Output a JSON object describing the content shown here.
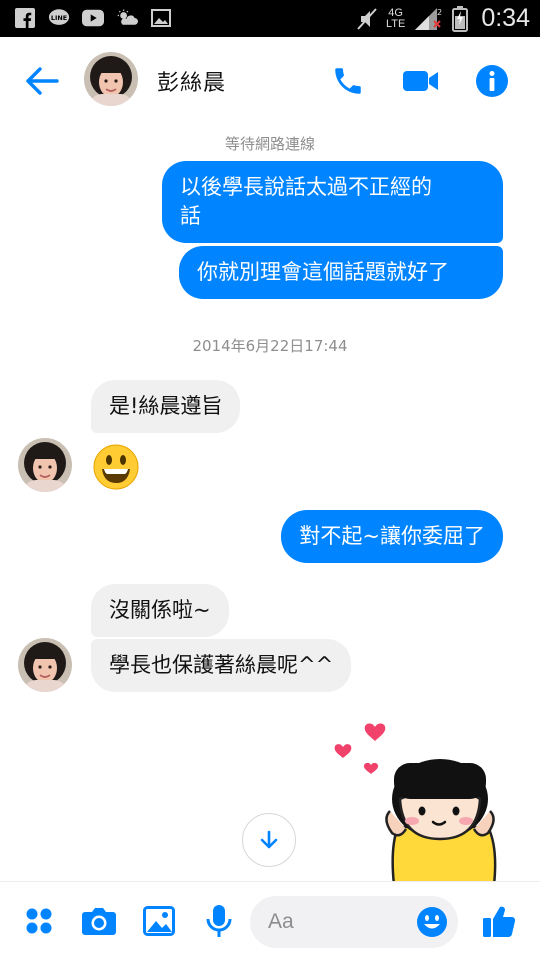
{
  "status_bar": {
    "network": "4G",
    "network_sub": "LTE",
    "sim_badge": "2",
    "time": "0:34",
    "icons": [
      "facebook-icon",
      "line-icon",
      "youtube-icon",
      "weather-icon",
      "gallery-icon",
      "mute-icon",
      "signal-icon",
      "battery-icon"
    ]
  },
  "header": {
    "contact_name": "彭絲晨",
    "icons": [
      "back-arrow-icon",
      "phone-icon",
      "video-camera-icon",
      "info-icon"
    ]
  },
  "thread": {
    "waiting_notice": "等待網路連線",
    "timestamp": "2014年6月22日17:44",
    "messages": [
      {
        "direction": "out",
        "text": "以後學長說話太過不正經的\n話"
      },
      {
        "direction": "out",
        "text": "你就別理會這個話題就好了"
      },
      {
        "direction": "in",
        "text": "是!絲晨遵旨"
      },
      {
        "direction": "in",
        "type": "emoji",
        "emoji": "grinning-face"
      },
      {
        "direction": "out",
        "text": "對不起~讓你委屈了"
      },
      {
        "direction": "in",
        "text": "沒關係啦~"
      },
      {
        "direction": "in",
        "text": "學長也保護著絲晨呢^^"
      }
    ],
    "sticker": "girl-with-hearts-sticker"
  },
  "composer": {
    "placeholder": "Aa",
    "icons": [
      "more-apps-icon",
      "camera-icon",
      "image-icon",
      "microphone-icon",
      "emoji-icon",
      "thumbs-up-icon"
    ]
  },
  "colors": {
    "accent": "#0084ff",
    "incoming_bubble": "#f1f0f0",
    "meta_text": "#8e8e8e"
  }
}
